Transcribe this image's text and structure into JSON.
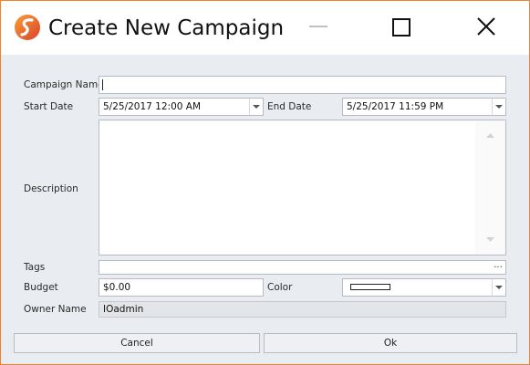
{
  "window": {
    "title": "Create New Campaign",
    "controls": {
      "minimize": "minimize-icon",
      "maximize": "maximize-icon",
      "close": "close-icon"
    },
    "accent_color": "#f0822d"
  },
  "form": {
    "campaign_name": {
      "label": "Campaign Name",
      "value": ""
    },
    "start_date": {
      "label": "Start Date",
      "value": "5/25/2017 12:00 AM"
    },
    "end_date": {
      "label": "End Date",
      "value": "5/25/2017 11:59 PM"
    },
    "description": {
      "label": "Description",
      "value": ""
    },
    "tags": {
      "label": "Tags",
      "value": "",
      "button": "..."
    },
    "budget": {
      "label": "Budget",
      "value": "$0.00"
    },
    "color": {
      "label": "Color",
      "value": "#ffffff"
    },
    "owner_name": {
      "label": "Owner Name",
      "value": "IOadmin"
    }
  },
  "buttons": {
    "cancel": "Cancel",
    "ok": "Ok"
  }
}
